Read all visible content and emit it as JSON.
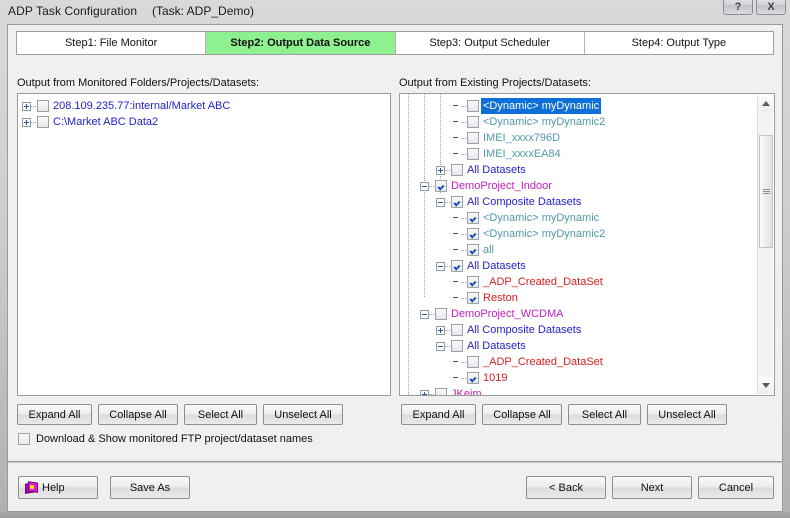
{
  "window": {
    "title": "ADP Task Configuration",
    "task_label": "(Task: ADP_Demo)",
    "help_button": "?",
    "close_button": "X"
  },
  "tabs": [
    {
      "label": "Step1: File Monitor",
      "active": false
    },
    {
      "label": "Step2: Output Data Source",
      "active": true
    },
    {
      "label": "Step3: Output Scheduler",
      "active": false
    },
    {
      "label": "Step4: Output Type",
      "active": false
    }
  ],
  "left_panel": {
    "label": "Output from Monitored Folders/Projects/Datasets:",
    "tree": [
      {
        "label": "208.109.235.77:internal/Market ABC",
        "color": "blue",
        "expander": "plus",
        "checked": false,
        "indent": 0,
        "selected": false
      },
      {
        "label": "C:\\Market ABC Data2",
        "color": "blue",
        "expander": "plus",
        "checked": false,
        "indent": 0,
        "selected": false
      }
    ],
    "buttons": [
      "Expand All",
      "Collapse All",
      "Select All",
      "Unselect All"
    ],
    "option": {
      "label": "Download & Show monitored FTP project/dataset names",
      "checked": false
    }
  },
  "right_panel": {
    "label": "Output from Existing Projects/Datasets:",
    "tree": [
      {
        "label": "<Dynamic>  myDynamic",
        "color": "teal",
        "expander": "none",
        "checked": false,
        "indent": 3,
        "selected": true
      },
      {
        "label": "<Dynamic>  myDynamic2",
        "color": "teal",
        "expander": "none",
        "checked": false,
        "indent": 3,
        "selected": false
      },
      {
        "label": "IMEI_xxxx796D",
        "color": "teal",
        "expander": "none",
        "checked": false,
        "indent": 3,
        "selected": false
      },
      {
        "label": "IMEI_xxxxEA84",
        "color": "teal",
        "expander": "none",
        "checked": false,
        "indent": 3,
        "selected": false
      },
      {
        "label": "All Datasets",
        "color": "blue",
        "expander": "plus",
        "checked": false,
        "indent": 2,
        "selected": false
      },
      {
        "label": "DemoProject_Indoor",
        "color": "magenta",
        "expander": "minus",
        "checked": true,
        "indent": 1,
        "selected": false
      },
      {
        "label": "All Composite Datasets",
        "color": "blue",
        "expander": "minus",
        "checked": true,
        "indent": 2,
        "selected": false
      },
      {
        "label": "<Dynamic>  myDynamic",
        "color": "teal",
        "expander": "none",
        "checked": true,
        "indent": 3,
        "selected": false
      },
      {
        "label": "<Dynamic>  myDynamic2",
        "color": "teal",
        "expander": "none",
        "checked": true,
        "indent": 3,
        "selected": false
      },
      {
        "label": "all",
        "color": "teal",
        "expander": "none",
        "checked": true,
        "indent": 3,
        "selected": false
      },
      {
        "label": "All Datasets",
        "color": "blue",
        "expander": "minus",
        "checked": true,
        "indent": 2,
        "selected": false
      },
      {
        "label": "_ADP_Created_DataSet",
        "color": "red",
        "expander": "none",
        "checked": true,
        "indent": 3,
        "selected": false
      },
      {
        "label": "Reston",
        "color": "red",
        "expander": "none",
        "checked": true,
        "indent": 3,
        "selected": false
      },
      {
        "label": "DemoProject_WCDMA",
        "color": "magenta",
        "expander": "minus",
        "checked": false,
        "indent": 1,
        "selected": false
      },
      {
        "label": "All Composite Datasets",
        "color": "blue",
        "expander": "plus",
        "checked": false,
        "indent": 2,
        "selected": false
      },
      {
        "label": "All Datasets",
        "color": "blue",
        "expander": "minus",
        "checked": false,
        "indent": 2,
        "selected": false
      },
      {
        "label": "_ADP_Created_DataSet",
        "color": "red",
        "expander": "none",
        "checked": false,
        "indent": 3,
        "selected": false
      },
      {
        "label": "1019",
        "color": "red",
        "expander": "none",
        "checked": true,
        "indent": 3,
        "selected": false
      },
      {
        "label": "JKeim",
        "color": "magenta",
        "expander": "plus",
        "checked": false,
        "indent": 1,
        "selected": false
      }
    ],
    "buttons": [
      "Expand All",
      "Collapse All",
      "Select All",
      "Unselect All"
    ],
    "scrollbar": {
      "up_arrow": "▲",
      "down_arrow": "▼"
    }
  },
  "footer": {
    "help_label": "Help",
    "save_as_label": "Save As",
    "back_label": "< Back",
    "next_label": "Next",
    "cancel_label": "Cancel"
  },
  "colors": {
    "active_tab": "#8ff08f",
    "selection": "#0f6fd8",
    "project": "#c020c0",
    "group": "#2222cc",
    "dataset": "#d02020",
    "dynamic": "#4f9aa8"
  }
}
